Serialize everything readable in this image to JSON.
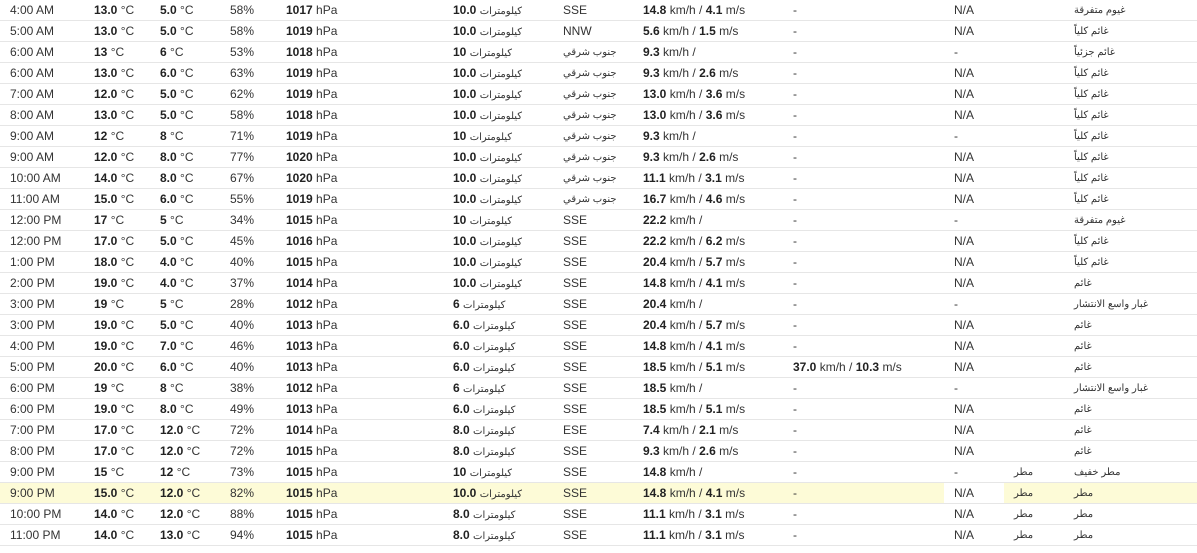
{
  "units": {
    "temp": "°C",
    "pressure": "hPa",
    "km": "كيلومترات",
    "kmh": "km/h",
    "ms": "m/s"
  },
  "rows": [
    {
      "time": "4:00 AM",
      "temp": "13.0",
      "dew": "5.0",
      "hum": "58%",
      "pres": "1017",
      "vis": "10.0",
      "dir": "SSE",
      "wind": "14.8",
      "wind_ms": "4.1",
      "gust_kmh": "",
      "gust_ms": "",
      "gust": "-",
      "heat": "N/A",
      "precip": "",
      "cond": "غيوم متفرقة",
      "hl": false,
      "ar_dir": false
    },
    {
      "time": "5:00 AM",
      "temp": "13.0",
      "dew": "5.0",
      "hum": "58%",
      "pres": "1019",
      "vis": "10.0",
      "dir": "NNW",
      "wind": "5.6",
      "wind_ms": "1.5",
      "gust_kmh": "",
      "gust_ms": "",
      "gust": "-",
      "heat": "N/A",
      "precip": "",
      "cond": "غائم كلياً",
      "hl": false,
      "ar_dir": false
    },
    {
      "time": "6:00 AM",
      "temp": "13",
      "dew": "6",
      "hum": "53%",
      "pres": "1018",
      "vis": "10",
      "dir": "جنوب شرقي",
      "wind": "9.3",
      "wind_ms": "",
      "gust_kmh": "",
      "gust_ms": "",
      "gust": "-",
      "heat": "-",
      "precip": "",
      "cond": "غائم جزئياً",
      "hl": false,
      "ar_dir": true
    },
    {
      "time": "6:00 AM",
      "temp": "13.0",
      "dew": "6.0",
      "hum": "63%",
      "pres": "1019",
      "vis": "10.0",
      "dir": "جنوب شرقي",
      "wind": "9.3",
      "wind_ms": "2.6",
      "gust_kmh": "",
      "gust_ms": "",
      "gust": "-",
      "heat": "N/A",
      "precip": "",
      "cond": "غائم كلياً",
      "hl": false,
      "ar_dir": true
    },
    {
      "time": "7:00 AM",
      "temp": "12.0",
      "dew": "5.0",
      "hum": "62%",
      "pres": "1019",
      "vis": "10.0",
      "dir": "جنوب شرقي",
      "wind": "13.0",
      "wind_ms": "3.6",
      "gust_kmh": "",
      "gust_ms": "",
      "gust": "-",
      "heat": "N/A",
      "precip": "",
      "cond": "غائم كلياً",
      "hl": false,
      "ar_dir": true
    },
    {
      "time": "8:00 AM",
      "temp": "13.0",
      "dew": "5.0",
      "hum": "58%",
      "pres": "1018",
      "vis": "10.0",
      "dir": "جنوب شرقي",
      "wind": "13.0",
      "wind_ms": "3.6",
      "gust_kmh": "",
      "gust_ms": "",
      "gust": "-",
      "heat": "N/A",
      "precip": "",
      "cond": "غائم كلياً",
      "hl": false,
      "ar_dir": true
    },
    {
      "time": "9:00 AM",
      "temp": "12",
      "dew": "8",
      "hum": "71%",
      "pres": "1019",
      "vis": "10",
      "dir": "جنوب شرقي",
      "wind": "9.3",
      "wind_ms": "",
      "gust_kmh": "",
      "gust_ms": "",
      "gust": "-",
      "heat": "-",
      "precip": "",
      "cond": "غائم كلياً",
      "hl": false,
      "ar_dir": true
    },
    {
      "time": "9:00 AM",
      "temp": "12.0",
      "dew": "8.0",
      "hum": "77%",
      "pres": "1020",
      "vis": "10.0",
      "dir": "جنوب شرقي",
      "wind": "9.3",
      "wind_ms": "2.6",
      "gust_kmh": "",
      "gust_ms": "",
      "gust": "-",
      "heat": "N/A",
      "precip": "",
      "cond": "غائم كلياً",
      "hl": false,
      "ar_dir": true
    },
    {
      "time": "10:00 AM",
      "temp": "14.0",
      "dew": "8.0",
      "hum": "67%",
      "pres": "1020",
      "vis": "10.0",
      "dir": "جنوب شرقي",
      "wind": "11.1",
      "wind_ms": "3.1",
      "gust_kmh": "",
      "gust_ms": "",
      "gust": "-",
      "heat": "N/A",
      "precip": "",
      "cond": "غائم كلياً",
      "hl": false,
      "ar_dir": true
    },
    {
      "time": "11:00 AM",
      "temp": "15.0",
      "dew": "6.0",
      "hum": "55%",
      "pres": "1019",
      "vis": "10.0",
      "dir": "جنوب شرقي",
      "wind": "16.7",
      "wind_ms": "4.6",
      "gust_kmh": "",
      "gust_ms": "",
      "gust": "-",
      "heat": "N/A",
      "precip": "",
      "cond": "غائم كلياً",
      "hl": false,
      "ar_dir": true
    },
    {
      "time": "12:00 PM",
      "temp": "17",
      "dew": "5",
      "hum": "34%",
      "pres": "1015",
      "vis": "10",
      "dir": "SSE",
      "wind": "22.2",
      "wind_ms": "",
      "gust_kmh": "",
      "gust_ms": "",
      "gust": "-",
      "heat": "-",
      "precip": "",
      "cond": "غيوم متفرقة",
      "hl": false,
      "ar_dir": false
    },
    {
      "time": "12:00 PM",
      "temp": "17.0",
      "dew": "5.0",
      "hum": "45%",
      "pres": "1016",
      "vis": "10.0",
      "dir": "SSE",
      "wind": "22.2",
      "wind_ms": "6.2",
      "gust_kmh": "",
      "gust_ms": "",
      "gust": "-",
      "heat": "N/A",
      "precip": "",
      "cond": "غائم كلياً",
      "hl": false,
      "ar_dir": false
    },
    {
      "time": "1:00 PM",
      "temp": "18.0",
      "dew": "4.0",
      "hum": "40%",
      "pres": "1015",
      "vis": "10.0",
      "dir": "SSE",
      "wind": "20.4",
      "wind_ms": "5.7",
      "gust_kmh": "",
      "gust_ms": "",
      "gust": "-",
      "heat": "N/A",
      "precip": "",
      "cond": "غائم كلياً",
      "hl": false,
      "ar_dir": false
    },
    {
      "time": "2:00 PM",
      "temp": "19.0",
      "dew": "4.0",
      "hum": "37%",
      "pres": "1014",
      "vis": "10.0",
      "dir": "SSE",
      "wind": "14.8",
      "wind_ms": "4.1",
      "gust_kmh": "",
      "gust_ms": "",
      "gust": "-",
      "heat": "N/A",
      "precip": "",
      "cond": "غائم",
      "hl": false,
      "ar_dir": false
    },
    {
      "time": "3:00 PM",
      "temp": "19",
      "dew": "5",
      "hum": "28%",
      "pres": "1012",
      "vis": "6",
      "dir": "SSE",
      "wind": "20.4",
      "wind_ms": "",
      "gust_kmh": "",
      "gust_ms": "",
      "gust": "-",
      "heat": "-",
      "precip": "",
      "cond": "غبار واسع الانتشار",
      "hl": false,
      "ar_dir": false
    },
    {
      "time": "3:00 PM",
      "temp": "19.0",
      "dew": "5.0",
      "hum": "40%",
      "pres": "1013",
      "vis": "6.0",
      "dir": "SSE",
      "wind": "20.4",
      "wind_ms": "5.7",
      "gust_kmh": "",
      "gust_ms": "",
      "gust": "-",
      "heat": "N/A",
      "precip": "",
      "cond": "غائم",
      "hl": false,
      "ar_dir": false
    },
    {
      "time": "4:00 PM",
      "temp": "19.0",
      "dew": "7.0",
      "hum": "46%",
      "pres": "1013",
      "vis": "6.0",
      "dir": "SSE",
      "wind": "14.8",
      "wind_ms": "4.1",
      "gust_kmh": "",
      "gust_ms": "",
      "gust": "-",
      "heat": "N/A",
      "precip": "",
      "cond": "غائم",
      "hl": false,
      "ar_dir": false
    },
    {
      "time": "5:00 PM",
      "temp": "20.0",
      "dew": "6.0",
      "hum": "40%",
      "pres": "1013",
      "vis": "6.0",
      "dir": "SSE",
      "wind": "18.5",
      "wind_ms": "5.1",
      "gust_kmh": "37.0",
      "gust_ms": "10.3",
      "gust": "",
      "heat": "N/A",
      "precip": "",
      "cond": "غائم",
      "hl": false,
      "ar_dir": false
    },
    {
      "time": "6:00 PM",
      "temp": "19",
      "dew": "8",
      "hum": "38%",
      "pres": "1012",
      "vis": "6",
      "dir": "SSE",
      "wind": "18.5",
      "wind_ms": "",
      "gust_kmh": "",
      "gust_ms": "",
      "gust": "-",
      "heat": "-",
      "precip": "",
      "cond": "غبار واسع الانتشار",
      "hl": false,
      "ar_dir": false
    },
    {
      "time": "6:00 PM",
      "temp": "19.0",
      "dew": "8.0",
      "hum": "49%",
      "pres": "1013",
      "vis": "6.0",
      "dir": "SSE",
      "wind": "18.5",
      "wind_ms": "5.1",
      "gust_kmh": "",
      "gust_ms": "",
      "gust": "-",
      "heat": "N/A",
      "precip": "",
      "cond": "غائم",
      "hl": false,
      "ar_dir": false
    },
    {
      "time": "7:00 PM",
      "temp": "17.0",
      "dew": "12.0",
      "hum": "72%",
      "pres": "1014",
      "vis": "8.0",
      "dir": "ESE",
      "wind": "7.4",
      "wind_ms": "2.1",
      "gust_kmh": "",
      "gust_ms": "",
      "gust": "-",
      "heat": "N/A",
      "precip": "",
      "cond": "غائم",
      "hl": false,
      "ar_dir": false
    },
    {
      "time": "8:00 PM",
      "temp": "17.0",
      "dew": "12.0",
      "hum": "72%",
      "pres": "1015",
      "vis": "8.0",
      "dir": "SSE",
      "wind": "9.3",
      "wind_ms": "2.6",
      "gust_kmh": "",
      "gust_ms": "",
      "gust": "-",
      "heat": "N/A",
      "precip": "",
      "cond": "غائم",
      "hl": false,
      "ar_dir": false
    },
    {
      "time": "9:00 PM",
      "temp": "15",
      "dew": "12",
      "hum": "73%",
      "pres": "1015",
      "vis": "10",
      "dir": "SSE",
      "wind": "14.8",
      "wind_ms": "",
      "gust_kmh": "",
      "gust_ms": "",
      "gust": "-",
      "heat": "-",
      "precip": "مطر",
      "cond": "مطر خفيف",
      "hl": false,
      "ar_dir": false
    },
    {
      "time": "9:00 PM",
      "temp": "15.0",
      "dew": "12.0",
      "hum": "82%",
      "pres": "1015",
      "vis": "10.0",
      "dir": "SSE",
      "wind": "14.8",
      "wind_ms": "4.1",
      "gust_kmh": "",
      "gust_ms": "",
      "gust": "-",
      "heat": "N/A",
      "precip": "مطر",
      "cond": "مطر",
      "hl": true,
      "ar_dir": false
    },
    {
      "time": "10:00 PM",
      "temp": "14.0",
      "dew": "12.0",
      "hum": "88%",
      "pres": "1015",
      "vis": "8.0",
      "dir": "SSE",
      "wind": "11.1",
      "wind_ms": "3.1",
      "gust_kmh": "",
      "gust_ms": "",
      "gust": "-",
      "heat": "N/A",
      "precip": "مطر",
      "cond": "مطر",
      "hl": false,
      "ar_dir": false
    },
    {
      "time": "11:00 PM",
      "temp": "14.0",
      "dew": "13.0",
      "hum": "94%",
      "pres": "1015",
      "vis": "8.0",
      "dir": "SSE",
      "wind": "11.1",
      "wind_ms": "3.1",
      "gust_kmh": "",
      "gust_ms": "",
      "gust": "-",
      "heat": "N/A",
      "precip": "مطر",
      "cond": "مطر",
      "hl": false,
      "ar_dir": false
    }
  ]
}
